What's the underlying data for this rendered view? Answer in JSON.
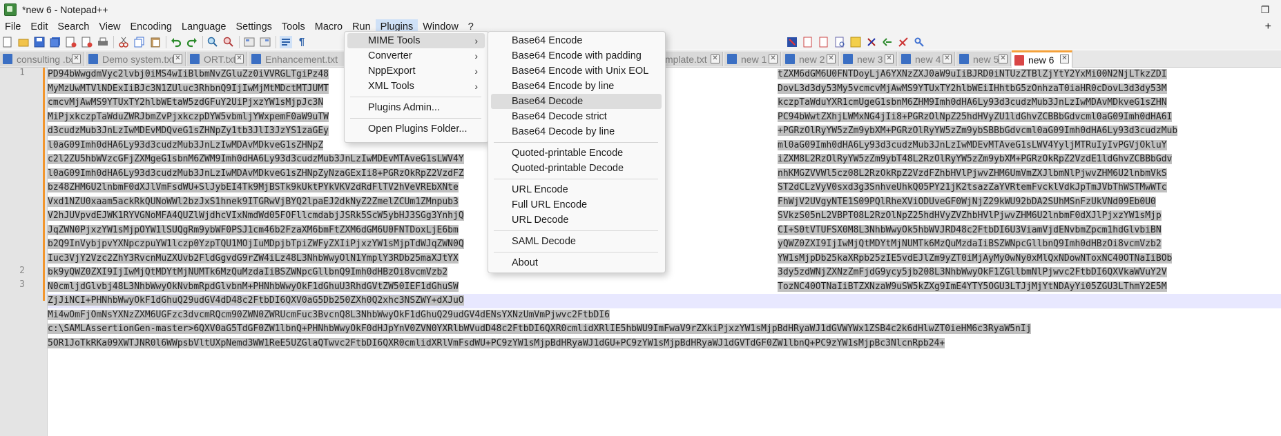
{
  "window": {
    "title": "*new 6 - Notepad++"
  },
  "menubar": {
    "items": [
      "File",
      "Edit",
      "Search",
      "View",
      "Encoding",
      "Language",
      "Settings",
      "Tools",
      "Macro",
      "Run",
      "Plugins",
      "Window",
      "?"
    ],
    "plus": "+"
  },
  "window_controls": {
    "minimize": "—",
    "maximize": "❐",
    "close": "✕"
  },
  "tabs": [
    {
      "label": "consulting .txt",
      "icon": "file-icon"
    },
    {
      "label": "Demo system.txt",
      "icon": "file-icon"
    },
    {
      "label": "ORT.txt",
      "icon": "file-icon"
    },
    {
      "label": "Enhancement.txt",
      "icon": "file-icon"
    },
    {
      "label": "mplate.txt",
      "icon": "file-icon"
    },
    {
      "label": "new 1",
      "icon": "file-icon"
    },
    {
      "label": "new 2",
      "icon": "file-icon"
    },
    {
      "label": "new 3",
      "icon": "file-icon"
    },
    {
      "label": "new 4",
      "icon": "file-icon"
    },
    {
      "label": "new 5",
      "icon": "file-icon"
    },
    {
      "label": "new 6",
      "icon": "unsaved-file-icon",
      "active": true
    }
  ],
  "plugins_menu": {
    "items": [
      "MIME Tools",
      "Converter",
      "NppExport",
      "XML Tools",
      "Plugins Admin...",
      "Open Plugins Folder..."
    ],
    "submenu_arrow": "›"
  },
  "mime_submenu": {
    "items": [
      "Base64 Encode",
      "Base64 Encode with padding",
      "Base64 Encode with Unix EOL",
      "Base64 Encode by line",
      "Base64 Decode",
      "Base64 Decode strict",
      "Base64 Decode by line",
      "Quoted-printable Encode",
      "Quoted-printable Decode",
      "URL Encode",
      "Full URL Encode",
      "URL Decode",
      "SAML Decode",
      "About"
    ],
    "highlighted": "Base64 Decode"
  },
  "editor": {
    "line_numbers": [
      "1",
      "2",
      "3"
    ],
    "lines": [
      {
        "left": "PD94bWwgdmVyc2lvbj0iMS4wIiBlbmNvZGluZz0iVVRGLTgiPz48",
        "right": "tZXM6dGM6U0FNTDoyLjA6YXNzZXJ0aW9uIiBJRD0iNTUzZTBlZjYtY2YxMi00N2NjLTkzZDI"
      },
      {
        "left": "MyMzUwMTVlNDExIiBJc3N1ZUluc3RhbnQ9IjIwMjMtMDctMTJUMT",
        "right": "DovL3d3dy53My5vcmcvMjAwMS9YTUxTY2hlbWEiIHhtbG5zOnhzaT0iaHR0cDovL3d3dy53M"
      },
      {
        "left": "cmcvMjAwMS9YTUxTY2hlbWEtaW5zdGFuY2UiPjxzYW1sMjpJc3N",
        "right": "kczpTaWduYXR1cmUgeG1sbnM6ZHM9Imh0dHA6Ly93d3cudzMub3JnLzIwMDAvMDkveG1sZHN"
      },
      {
        "left": "MiPjxkczpTaWduZWRJbmZvPjxkczpDYW5vbmljYWxpemF0aW9uTW",
        "right": "PC94bWwtZXhjLWMxNG4jIi8+PGRzOlNpZ25hdHVyZU1ldGhvZCBBbGdvcml0aG09Imh0dHA6I"
      },
      {
        "left": "d3cudzMub3JnLzIwMDEvMDQveG1sZHNpZy1tb3JlI3JzYS1zaGEy",
        "right": "+PGRzOlRyYW5zZm9ybXM+PGRzOlRyYW5zZm9ybSBBbGdvcml0aG09Imh0dHA6Ly93d3cudzMub"
      },
      {
        "left": "l0aG09Imh0dHA6Ly93d3cudzMub3JnLzIwMDAvMDkveG1sZHNpZ",
        "right": "ml0aG09Imh0dHA6Ly93d3cudzMub3JnLzIwMDEvMTAveG1sLWV4YyljMTRuIyIvPGVjOkluY"
      },
      {
        "left": "c2l2ZU5hbWVzcGFjZXMgeG1sbnM6ZWM9Imh0dHA6Ly93d3cudzMub3JnLzIwMDEvMTAveG1sLWV4Y",
        "right": "iZXM8L2RzOlRyYW5zZm9ybT48L2RzOlRyYW5zZm9ybXM+PGRzOkRpZ2VzdE1ldGhvZCBBbGdv"
      },
      {
        "left": "l0aG09Imh0dHA6Ly93d3cudzMub3JnLzIwMDAvMDkveG1sZHNpZyNzaGExIi8+PGRzOkRpZ2VzdFZ",
        "right": "nhKMGZVVWl5cz08L2RzOkRpZ2VzdFZhbHVlPjwvZHM6UmVmZXJlbmNlPjwvZHM6U2lnbmVkS"
      },
      {
        "left": "bz48ZHM6U2lnbmF0dXJlVmFsdWU+SlJybEI4Tk9MjBSTk9kUktPYkVKV2dRdFlTV2hVeVREbXNte",
        "right": "ST2dCLzVyV0sxd3g3SnhveUhkQ05PY21jK2tsazZaYVRtemFvcklVdkJpTmJVbThWSTMwWTc"
      },
      {
        "left": "Vxd1NZU0xaam5ackRkQUNoWWl2bzJxS1hnek9ITGRwVjBYQ2lpaEJ2dkNyZ2ZmelZCUm1ZMnpub3",
        "right": "FhWjV2UVgyNTE1S09PQlRheXViODUveGF0WjNjZ29kWU92bDA2SUhMSnFzUkVNd09Eb0U0"
      },
      {
        "left": "V2hJUVpvdEJWK1RYVGNoMFA4QUZlWjdhcVIxNmdWd05FOFllcmdabjJSRk5ScW5ybHJ3SGg3YnhjQ",
        "right": "SVkzS05nL2VBPT08L2RzOlNpZ25hdHVyZVZhbHVlPjwvZHM6U2lnbmF0dXJlPjxzYW1sMjp"
      },
      {
        "left": "JqZWN0PjxzYW1sMjpOYW1lSUQgRm9ybWF0PSJ1cm46b2FzaXM6bmFtZXM6dGM6U0FNTDoxLjE6bm",
        "right": "CI+S0tVTUFSX0M8L3NhbWwyOk5hbWVJRD48c2FtbDI6U3ViamVjdENvbmZpcm1hdGlvbiBN"
      },
      {
        "left": "b2Q9InVybjpvYXNpczpuYW1lczp0YzpTQU1MOjIuMDpjbTpiZWFyZXIiPjxzYW1sMjpTdWJqZWN0Q",
        "right": "yQWZ0ZXI9IjIwMjQtMDYtMjNUMTk6MzQuMzdaIiBSZWNpcGllbnQ9Imh0dHBzOi8vcmVzb2"
      },
      {
        "left": "Iuc3VjY2Vzc2ZhY3RvcnMuZXUvb2FldGgvdG9rZW4iLz48L3NhbWwyOlN1YmplY3RDb25maXJtYX",
        "right": "YW1sMjpDb25kaXRpb25zIE5vdEJlZm9yZT0iMjAyMy0wNy0xMlQxNDowNToxNC40OTNaIiBOb"
      },
      {
        "left": "bk9yQWZ0ZXI9IjIwMjQtMDYtMjNUMTk6MzQuMzdaIiBSZWNpcGllbnQ9Imh0dHBzOi8vcmVzb2",
        "right": "3dy5zdWNjZXNzZmFjdG9ycy5jb208L3NhbWwyOkF1ZGllbmNlPjwvc2FtbDI6QXVkaWVuY2V"
      },
      {
        "left": "N0cmljdGlvbj48L3NhbWwyOkNvbmRpdGlvbnM+PHNhbWwyOkF1dGhuU3RhdGVtZW50IEF1dGhuSW",
        "right": "TozNC40OTNaIiBTZXNzaW9uSW5kZXg9ImE4YTY5OGU3LTJjMjYtNDAyYi05ZGU3LThmY2E5M"
      },
      {
        "left": "ZjJiNCI+PHNhbWwyOkF1dGhuQ29udGV4dD48c2FtbDI6QXV0aG5Db250ZXh0Q2xhc3NSZWY+dXJuO",
        "right": ""
      }
    ],
    "line2": "Mi4wOmFjOmNsYXNzZXM6UGFzc3dvcmRQcm90ZWN0ZWRUcmFuc3BvcnQ8L3NhbWwyOkF1dGhuQ29udGV4dENsYXNzUmVmPjwvc2FtbDI6",
    "line3a": "c:\\SAMLAssertionGen-master>6QXV0aG5TdGF0ZW1lbnQ+PHNhbWwyOkF0dHJpYnV0ZVN0YXRlbWVudD48c2FtbDI6QXR0cmlidXRlIE5hbWU9ImFwaV9rZXkiPjxzYW1sMjpBdHRyaWJ1dGVWYWx1ZSB4c2k6dHlwZT0ieHM6c3RyaW5nIj",
    "line3b": "5OR1JoTkRKa09XWTJNR0l6WWpsbVltUXpNemd3WW1ReE5UZGlaQTwvc2FtbDI6QXR0cmlidXRlVmFsdWU+PC9zYW1sMjpBdHRyaWJ1dGU+PC9zYW1sMjpBdHRyaWJ1dGVTdGF0ZW1lbnQ+PC9zYW1sMjpBc3NlcnRpb24+"
  }
}
